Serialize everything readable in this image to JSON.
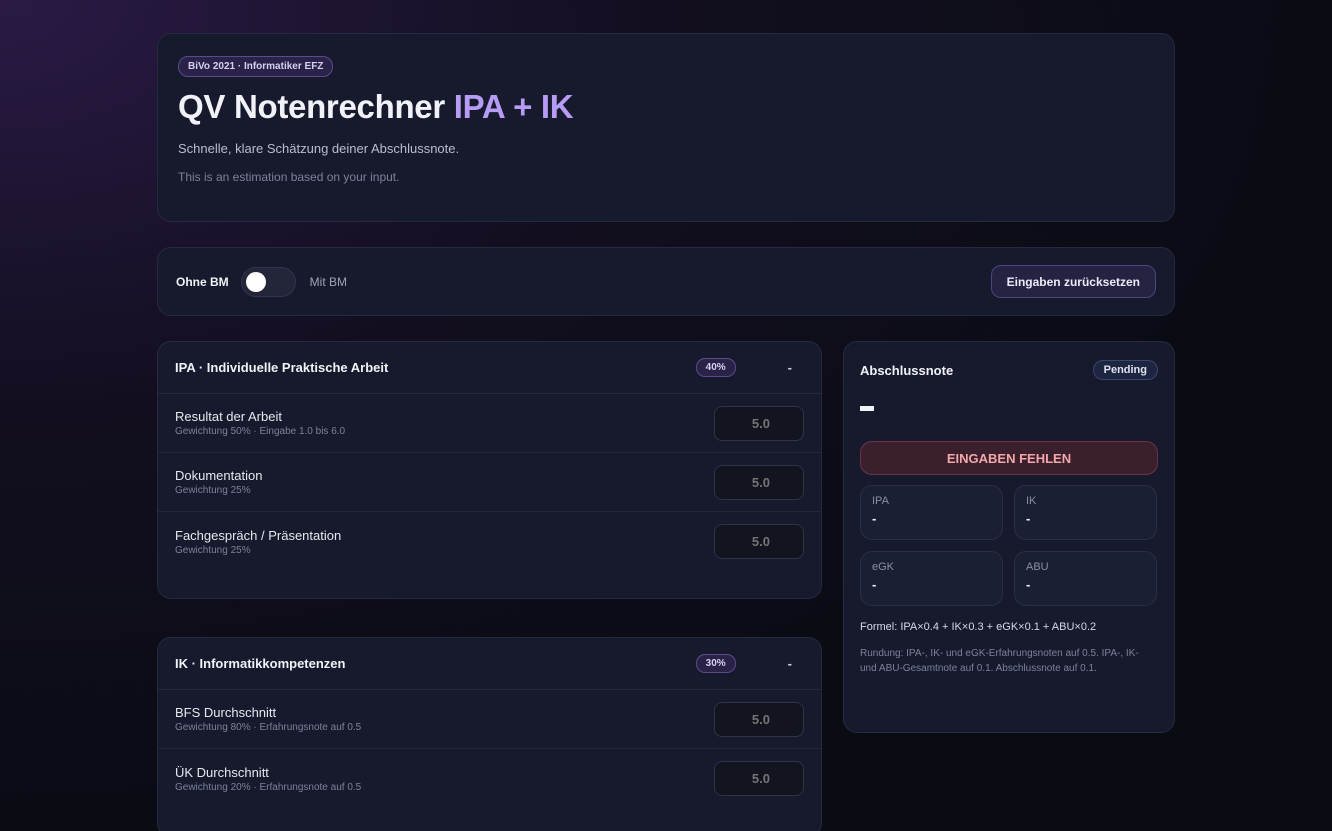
{
  "header": {
    "badge": "BiVo 2021 · Informatiker EFZ",
    "title_main": "QV Notenrechner ",
    "title_accent": "IPA + IK",
    "subtitle": "Schnelle, klare Schätzung deiner Abschlussnote.",
    "note": "This is an estimation based on your input."
  },
  "toolbar": {
    "toggle_off_label": "Ohne BM",
    "toggle_on_label": "Mit BM",
    "reset_label": "Eingaben zurücksetzen"
  },
  "ipa": {
    "title": "IPA · Individuelle Praktische Arbeit",
    "weight": "40%",
    "collapse": "-",
    "rows": [
      {
        "label": "Resultat der Arbeit",
        "sub": "Gewichtung 50% · Eingabe 1.0 bis 6.0",
        "placeholder": "5.0"
      },
      {
        "label": "Dokumentation",
        "sub": "Gewichtung 25%",
        "placeholder": "5.0"
      },
      {
        "label": "Fachgespräch / Präsentation",
        "sub": "Gewichtung 25%",
        "placeholder": "5.0"
      }
    ]
  },
  "ik": {
    "title": "IK · Informatikkompetenzen",
    "weight": "30%",
    "collapse": "-",
    "rows": [
      {
        "label": "BFS Durchschnitt",
        "sub": "Gewichtung 80% · Erfahrungsnote auf 0.5",
        "placeholder": "5.0"
      },
      {
        "label": "ÜK Durchschnitt",
        "sub": "Gewichtung 20% · Erfahrungsnote auf 0.5",
        "placeholder": "5.0"
      }
    ]
  },
  "result": {
    "title": "Abschlussnote",
    "status": "Pending",
    "alert": "EINGABEN FEHLEN",
    "metrics": [
      {
        "label": "IPA",
        "value": "-"
      },
      {
        "label": "IK",
        "value": "-"
      },
      {
        "label": "eGK",
        "value": "-"
      },
      {
        "label": "ABU",
        "value": "-"
      }
    ],
    "formula": "Formel: IPA×0.4 + IK×0.3 + eGK×0.1 + ABU×0.2",
    "rounding": "Rundung: IPA-, IK- und eGK-Erfahrungsnoten auf 0.5. IPA-, IK- und ABU-Gesamtnote auf 0.1. Abschlussnote auf 0.1."
  }
}
